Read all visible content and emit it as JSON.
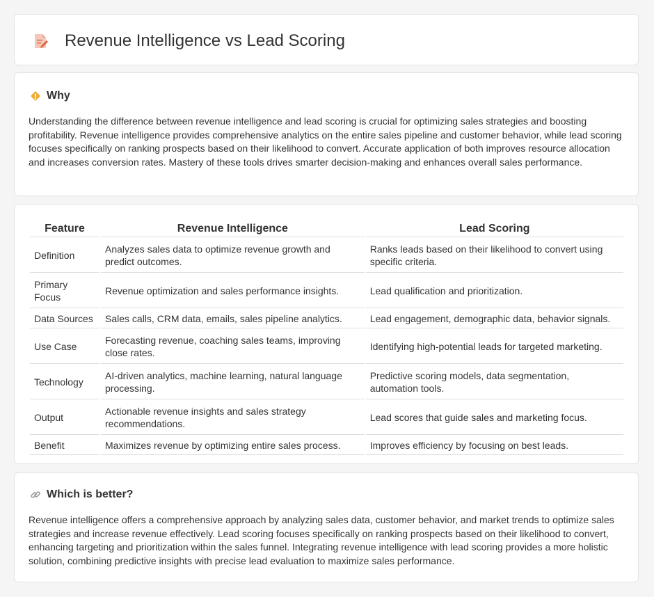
{
  "header": {
    "title": "Revenue Intelligence vs Lead Scoring",
    "icon": "document-edit-icon"
  },
  "why": {
    "heading": "Why",
    "icon": "diamond-warning-icon",
    "text": "Understanding the difference between revenue intelligence and lead scoring is crucial for optimizing sales strategies and boosting profitability. Revenue intelligence provides comprehensive analytics on the entire sales pipeline and customer behavior, while lead scoring focuses specifically on ranking prospects based on their likelihood to convert. Accurate application of both improves resource allocation and increases conversion rates. Mastery of these tools drives smarter decision-making and enhances overall sales performance."
  },
  "table": {
    "headers": [
      "Feature",
      "Revenue Intelligence",
      "Lead Scoring"
    ],
    "rows": [
      [
        "Definition",
        "Analyzes sales data to optimize revenue growth and predict outcomes.",
        "Ranks leads based on their likelihood to convert using specific criteria."
      ],
      [
        "Primary Focus",
        "Revenue optimization and sales performance insights.",
        "Lead qualification and prioritization."
      ],
      [
        "Data Sources",
        "Sales calls, CRM data, emails, sales pipeline analytics.",
        "Lead engagement, demographic data, behavior signals."
      ],
      [
        "Use Case",
        "Forecasting revenue, coaching sales teams, improving close rates.",
        "Identifying high-potential leads for targeted marketing."
      ],
      [
        "Technology",
        "AI-driven analytics, machine learning, natural language processing.",
        "Predictive scoring models, data segmentation, automation tools."
      ],
      [
        "Output",
        "Actionable revenue insights and sales strategy recommendations.",
        "Lead scores that guide sales and marketing focus."
      ],
      [
        "Benefit",
        "Maximizes revenue by optimizing entire sales process.",
        "Improves efficiency by focusing on best leads."
      ]
    ]
  },
  "better": {
    "heading": "Which is better?",
    "icon": "link-icon",
    "text": "Revenue intelligence offers a comprehensive approach by analyzing sales data, customer behavior, and market trends to optimize sales strategies and increase revenue effectively. Lead scoring focuses specifically on ranking prospects based on their likelihood to convert, enhancing targeting and prioritization within the sales funnel. Integrating revenue intelligence with lead scoring provides a more holistic solution, combining predictive insights with precise lead evaluation to maximize sales performance."
  }
}
